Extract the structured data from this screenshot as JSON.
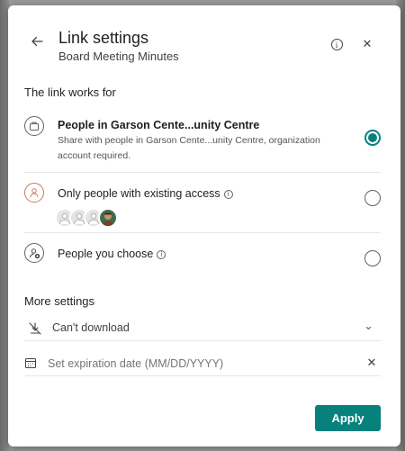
{
  "header": {
    "title": "Link settings",
    "subtitle": "Board Meeting Minutes",
    "info_glyph": "i",
    "close_glyph": "✕",
    "back_glyph": "←"
  },
  "link_works_for": {
    "label": "The link works for",
    "options": [
      {
        "title": "People in Garson Cente...unity Centre",
        "description": "Share with people in Garson Cente...unity Centre, organization account required.",
        "icon": "building-icon",
        "selected": true
      },
      {
        "title": "Only people with existing access",
        "icon": "person-icon",
        "has_info": true,
        "selected": false
      },
      {
        "title": "People you choose",
        "icon": "person-add-icon",
        "has_info": true,
        "selected": false
      }
    ],
    "info_glyph": "i"
  },
  "more_settings": {
    "label": "More settings",
    "download": {
      "value": "Can't download",
      "icon": "download-blocked-icon",
      "chevron": "⌄"
    },
    "expiration": {
      "placeholder": "Set expiration date (MM/DD/YYYY)",
      "icon": "calendar-icon",
      "clear_glyph": "✕"
    }
  },
  "footer": {
    "apply_label": "Apply"
  },
  "colors": {
    "accent": "#07817c",
    "text": "#242424",
    "divider": "#e6e6e6"
  }
}
